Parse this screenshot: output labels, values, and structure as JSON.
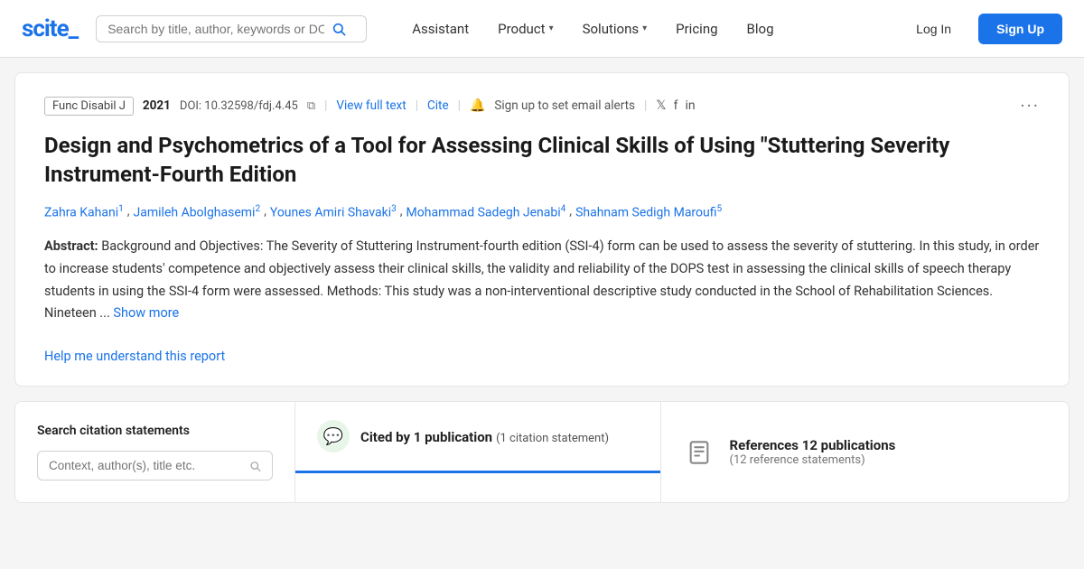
{
  "brand": {
    "logo": "scite_"
  },
  "navbar": {
    "search_placeholder": "Search by title, author, keywords or DOI",
    "items": [
      {
        "label": "Assistant",
        "has_chevron": false
      },
      {
        "label": "Product",
        "has_chevron": true
      },
      {
        "label": "Solutions",
        "has_chevron": true
      },
      {
        "label": "Pricing",
        "has_chevron": false
      },
      {
        "label": "Blog",
        "has_chevron": false
      }
    ],
    "login_label": "Log In",
    "signup_label": "Sign Up"
  },
  "article": {
    "journal": "Func Disabil J",
    "year": "2021",
    "doi": "DOI: 10.32598/fdj.4.45",
    "view_full_text": "View full text",
    "cite": "Cite",
    "alert_text": "Sign up to set email alerts",
    "title": "Design and Psychometrics of a Tool for Assessing Clinical Skills of Using \"Stuttering Severity Instrument-Fourth Edition",
    "authors": [
      {
        "name": "Zahra Kahani",
        "sup": "1"
      },
      {
        "name": "Jamileh Abolghasemi",
        "sup": "2"
      },
      {
        "name": "Younes Amiri Shavaki",
        "sup": "3"
      },
      {
        "name": "Mohammad Sadegh Jenabi",
        "sup": "4"
      },
      {
        "name": "Shahnam Sedigh Maroufi",
        "sup": "5"
      }
    ],
    "abstract_label": "Abstract:",
    "abstract_text": "Background and Objectives: The Severity of Stuttering Instrument-fourth edition (SSI-4) form can be used to assess the severity of stuttering. In this study, in order to increase students' competence and objectively assess their clinical skills, the validity and reliability of the DOPS test in assessing the clinical skills of speech therapy students in using the SSI-4 form were assessed. Methods: This study was a non-interventional descriptive study conducted in the School of Rehabilitation Sciences. Nineteen ...",
    "show_more": "Show more",
    "help_link": "Help me understand this report"
  },
  "panels": {
    "search_label": "Search citation statements",
    "search_placeholder": "Context, author(s), title etc.",
    "cited_label": "Cited by 1 publication",
    "cited_sub": "(1 citation statement)",
    "references_label": "References 12 publications",
    "references_sub": "(12 reference statements)"
  }
}
